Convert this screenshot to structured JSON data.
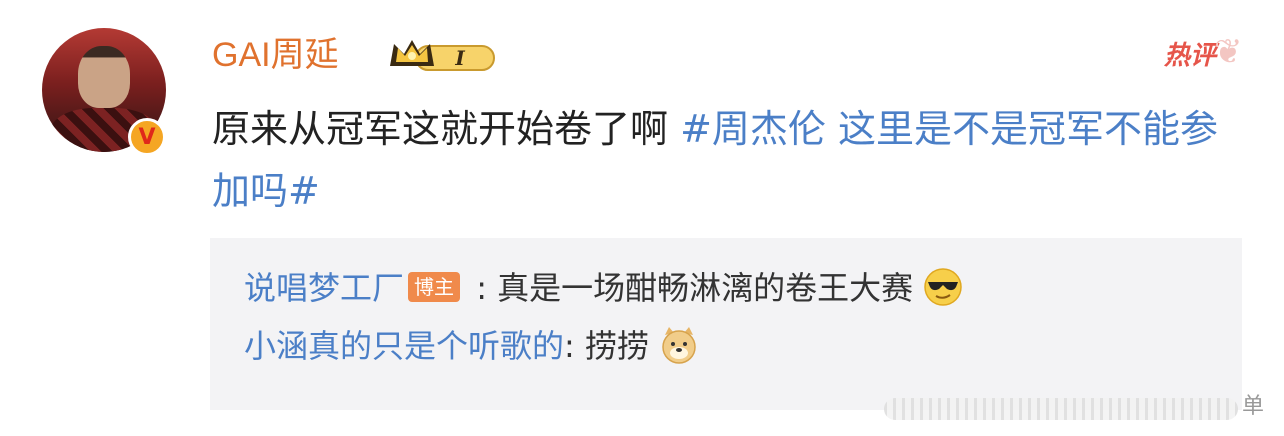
{
  "post": {
    "username": "GAI周延",
    "member_level": "I",
    "hot_label": "热评",
    "content_text": "原来从冠军这就开始卷了啊 ",
    "topic": "#周杰伦 这里是不是冠军不能参加吗#"
  },
  "replies": [
    {
      "name": "说唱梦工厂",
      "badge": "博主",
      "separator": " : ",
      "text": "真是一场酣畅淋漓的卷王大赛",
      "emoji": "sunglasses-face"
    },
    {
      "name": "小涵真的只是个听歌的",
      "badge": "",
      "separator": ": ",
      "text": "捞捞",
      "emoji": "doge-face"
    }
  ],
  "watermark": {
    "text": "单"
  },
  "colors": {
    "username": "#e0722e",
    "topic_link": "#4b7fc7",
    "hot": "#e6554a",
    "badge": "#f08a4b",
    "reply_bg": "#f3f3f5",
    "verified": "#f5a623"
  }
}
